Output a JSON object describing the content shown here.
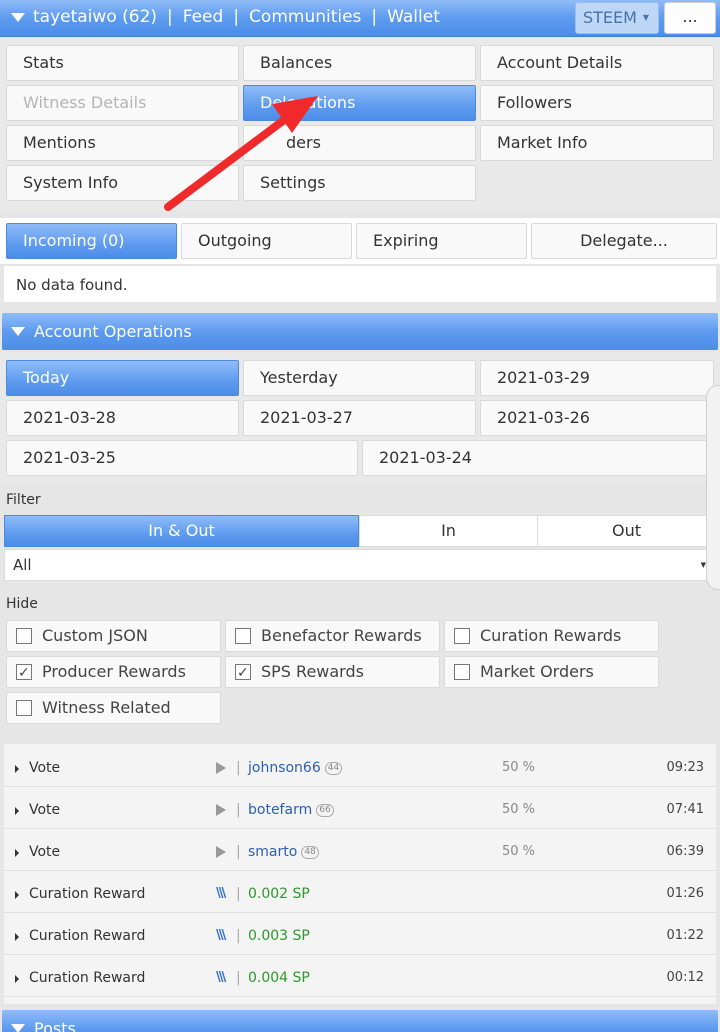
{
  "header": {
    "account": "tayetaiwo (62)",
    "links": [
      "Feed",
      "Communities",
      "Wallet"
    ],
    "currency": "STEEM",
    "more_label": "..."
  },
  "menu": {
    "items": [
      {
        "label": "Stats"
      },
      {
        "label": "Balances"
      },
      {
        "label": "Account Details"
      },
      {
        "label": "Witness Details"
      },
      {
        "label": "Delegations"
      },
      {
        "label": "Followers"
      },
      {
        "label": "Mentions"
      },
      {
        "label": "Orders"
      },
      {
        "label": "Market Info"
      },
      {
        "label": "System Info"
      },
      {
        "label": "Settings"
      }
    ],
    "visible_orders_fragment": "ders"
  },
  "delegations": {
    "tabs": [
      "Incoming (0)",
      "Outgoing",
      "Expiring",
      "Delegate..."
    ],
    "empty_text": "No data found."
  },
  "account_operations": {
    "title": "Account Operations",
    "dates": [
      "Today",
      "Yesterday",
      "2021-03-29",
      "2021-03-28",
      "2021-03-27",
      "2021-03-26",
      "2021-03-25",
      "2021-03-24"
    ],
    "filter_label": "Filter",
    "filter_options": [
      "In & Out",
      "In",
      "Out"
    ],
    "select_value": "All",
    "hide_label": "Hide",
    "hide_options": [
      {
        "label": "Custom JSON",
        "checked": false
      },
      {
        "label": "Benefactor Rewards",
        "checked": false
      },
      {
        "label": "Curation Rewards",
        "checked": false
      },
      {
        "label": "Producer Rewards",
        "checked": true
      },
      {
        "label": "SPS Rewards",
        "checked": true
      },
      {
        "label": "Market Orders",
        "checked": false
      },
      {
        "label": "Witness Related",
        "checked": false
      }
    ],
    "operations": [
      {
        "type": "Vote",
        "icon": "play-icon",
        "who": "johnson66",
        "rep": "44",
        "pct": "50 %",
        "time": "09:23"
      },
      {
        "type": "Vote",
        "icon": "play-icon",
        "who": "botefarm",
        "rep": "66",
        "pct": "50 %",
        "time": "07:41"
      },
      {
        "type": "Vote",
        "icon": "play-icon",
        "who": "smarto",
        "rep": "48",
        "pct": "50 %",
        "time": "06:39"
      },
      {
        "type": "Curation Reward",
        "icon": "steem-icon",
        "amount": "0.002 SP",
        "time": "01:26"
      },
      {
        "type": "Curation Reward",
        "icon": "steem-icon",
        "amount": "0.003 SP",
        "time": "01:22"
      },
      {
        "type": "Curation Reward",
        "icon": "steem-icon",
        "amount": "0.004 SP",
        "time": "00:12"
      }
    ]
  },
  "posts": {
    "title": "Posts"
  },
  "colors": {
    "accent": "#5e9bef",
    "annotation_arrow": "#f0292b",
    "amount_green": "#2a9a2a",
    "link_blue": "#2b5fb0"
  }
}
